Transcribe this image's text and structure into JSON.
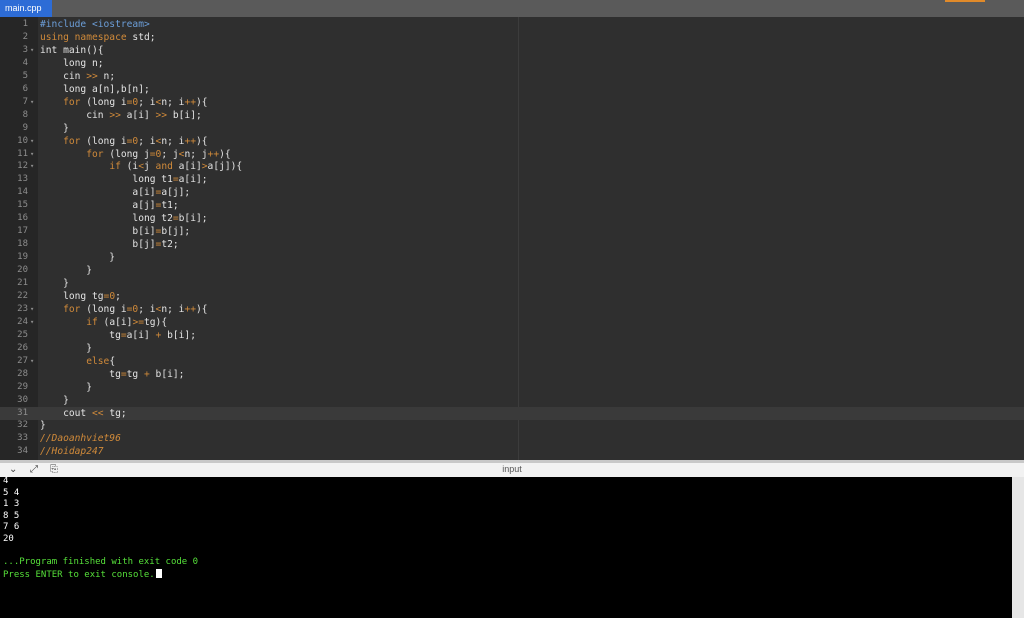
{
  "tab": {
    "label": "main.cpp"
  },
  "editor": {
    "active_line": 31,
    "lines": [
      {
        "n": "1",
        "fold": false,
        "tokens": [
          {
            "t": "#include <iostream>",
            "c": "#6c9ed8"
          }
        ]
      },
      {
        "n": "2",
        "fold": false,
        "tokens": [
          {
            "t": "using namespace",
            "c": "#d08a3a"
          },
          {
            "t": " std;",
            "c": "#e4e4e4"
          }
        ]
      },
      {
        "n": "3",
        "fold": true,
        "tokens": [
          {
            "t": "int main(){",
            "c": "#e4e4e4"
          }
        ]
      },
      {
        "n": "4",
        "fold": false,
        "tokens": [
          {
            "t": "    long n;",
            "c": "#e4e4e4"
          }
        ]
      },
      {
        "n": "5",
        "fold": false,
        "tokens": [
          {
            "t": "    cin ",
            "c": "#e4e4e4"
          },
          {
            "t": ">>",
            "c": "#d08a3a"
          },
          {
            "t": " n;",
            "c": "#e4e4e4"
          }
        ]
      },
      {
        "n": "6",
        "fold": false,
        "tokens": [
          {
            "t": "    long a[n],b[n];",
            "c": "#e4e4e4"
          }
        ]
      },
      {
        "n": "7",
        "fold": true,
        "tokens": [
          {
            "t": "    ",
            "c": "#e4e4e4"
          },
          {
            "t": "for",
            "c": "#d08a3a"
          },
          {
            "t": " (long i",
            "c": "#e4e4e4"
          },
          {
            "t": "=0",
            "c": "#d08a3a"
          },
          {
            "t": "; i",
            "c": "#e4e4e4"
          },
          {
            "t": "<",
            "c": "#d08a3a"
          },
          {
            "t": "n; i",
            "c": "#e4e4e4"
          },
          {
            "t": "++",
            "c": "#d08a3a"
          },
          {
            "t": "){",
            "c": "#e4e4e4"
          }
        ]
      },
      {
        "n": "8",
        "fold": false,
        "tokens": [
          {
            "t": "        cin ",
            "c": "#e4e4e4"
          },
          {
            "t": ">>",
            "c": "#d08a3a"
          },
          {
            "t": " a[i] ",
            "c": "#e4e4e4"
          },
          {
            "t": ">>",
            "c": "#d08a3a"
          },
          {
            "t": " b[i];",
            "c": "#e4e4e4"
          }
        ]
      },
      {
        "n": "9",
        "fold": false,
        "tokens": [
          {
            "t": "    }",
            "c": "#e4e4e4"
          }
        ]
      },
      {
        "n": "10",
        "fold": true,
        "tokens": [
          {
            "t": "    ",
            "c": "#e4e4e4"
          },
          {
            "t": "for",
            "c": "#d08a3a"
          },
          {
            "t": " (long i",
            "c": "#e4e4e4"
          },
          {
            "t": "=0",
            "c": "#d08a3a"
          },
          {
            "t": "; i",
            "c": "#e4e4e4"
          },
          {
            "t": "<",
            "c": "#d08a3a"
          },
          {
            "t": "n; i",
            "c": "#e4e4e4"
          },
          {
            "t": "++",
            "c": "#d08a3a"
          },
          {
            "t": "){",
            "c": "#e4e4e4"
          }
        ]
      },
      {
        "n": "11",
        "fold": true,
        "tokens": [
          {
            "t": "        ",
            "c": "#e4e4e4"
          },
          {
            "t": "for",
            "c": "#d08a3a"
          },
          {
            "t": " (long j",
            "c": "#e4e4e4"
          },
          {
            "t": "=0",
            "c": "#d08a3a"
          },
          {
            "t": "; j",
            "c": "#e4e4e4"
          },
          {
            "t": "<",
            "c": "#d08a3a"
          },
          {
            "t": "n; j",
            "c": "#e4e4e4"
          },
          {
            "t": "++",
            "c": "#d08a3a"
          },
          {
            "t": "){",
            "c": "#e4e4e4"
          }
        ]
      },
      {
        "n": "12",
        "fold": true,
        "tokens": [
          {
            "t": "            ",
            "c": "#e4e4e4"
          },
          {
            "t": "if",
            "c": "#d08a3a"
          },
          {
            "t": " (i",
            "c": "#e4e4e4"
          },
          {
            "t": "<",
            "c": "#d08a3a"
          },
          {
            "t": "j ",
            "c": "#e4e4e4"
          },
          {
            "t": "and",
            "c": "#d08a3a"
          },
          {
            "t": " a[i]",
            "c": "#e4e4e4"
          },
          {
            "t": ">",
            "c": "#d08a3a"
          },
          {
            "t": "a[j]){",
            "c": "#e4e4e4"
          }
        ]
      },
      {
        "n": "13",
        "fold": false,
        "tokens": [
          {
            "t": "                long t1",
            "c": "#e4e4e4"
          },
          {
            "t": "=",
            "c": "#d08a3a"
          },
          {
            "t": "a[i];",
            "c": "#e4e4e4"
          }
        ]
      },
      {
        "n": "14",
        "fold": false,
        "tokens": [
          {
            "t": "                a[i]",
            "c": "#e4e4e4"
          },
          {
            "t": "=",
            "c": "#d08a3a"
          },
          {
            "t": "a[j];",
            "c": "#e4e4e4"
          }
        ]
      },
      {
        "n": "15",
        "fold": false,
        "tokens": [
          {
            "t": "                a[j]",
            "c": "#e4e4e4"
          },
          {
            "t": "=",
            "c": "#d08a3a"
          },
          {
            "t": "t1;",
            "c": "#e4e4e4"
          }
        ]
      },
      {
        "n": "16",
        "fold": false,
        "tokens": [
          {
            "t": "                long t2",
            "c": "#e4e4e4"
          },
          {
            "t": "=",
            "c": "#d08a3a"
          },
          {
            "t": "b[i];",
            "c": "#e4e4e4"
          }
        ]
      },
      {
        "n": "17",
        "fold": false,
        "tokens": [
          {
            "t": "                b[i]",
            "c": "#e4e4e4"
          },
          {
            "t": "=",
            "c": "#d08a3a"
          },
          {
            "t": "b[j];",
            "c": "#e4e4e4"
          }
        ]
      },
      {
        "n": "18",
        "fold": false,
        "tokens": [
          {
            "t": "                b[j]",
            "c": "#e4e4e4"
          },
          {
            "t": "=",
            "c": "#d08a3a"
          },
          {
            "t": "t2;",
            "c": "#e4e4e4"
          }
        ]
      },
      {
        "n": "19",
        "fold": false,
        "tokens": [
          {
            "t": "            }",
            "c": "#e4e4e4"
          }
        ]
      },
      {
        "n": "20",
        "fold": false,
        "tokens": [
          {
            "t": "        }",
            "c": "#e4e4e4"
          }
        ]
      },
      {
        "n": "21",
        "fold": false,
        "tokens": [
          {
            "t": "    }",
            "c": "#e4e4e4"
          }
        ]
      },
      {
        "n": "22",
        "fold": false,
        "tokens": [
          {
            "t": "    long tg",
            "c": "#e4e4e4"
          },
          {
            "t": "=0",
            "c": "#d08a3a"
          },
          {
            "t": ";",
            "c": "#e4e4e4"
          }
        ]
      },
      {
        "n": "23",
        "fold": true,
        "tokens": [
          {
            "t": "    ",
            "c": "#e4e4e4"
          },
          {
            "t": "for",
            "c": "#d08a3a"
          },
          {
            "t": " (long i",
            "c": "#e4e4e4"
          },
          {
            "t": "=0",
            "c": "#d08a3a"
          },
          {
            "t": "; i",
            "c": "#e4e4e4"
          },
          {
            "t": "<",
            "c": "#d08a3a"
          },
          {
            "t": "n; i",
            "c": "#e4e4e4"
          },
          {
            "t": "++",
            "c": "#d08a3a"
          },
          {
            "t": "){",
            "c": "#e4e4e4"
          }
        ]
      },
      {
        "n": "24",
        "fold": true,
        "tokens": [
          {
            "t": "        ",
            "c": "#e4e4e4"
          },
          {
            "t": "if",
            "c": "#d08a3a"
          },
          {
            "t": " (a[i]",
            "c": "#e4e4e4"
          },
          {
            "t": ">=",
            "c": "#d08a3a"
          },
          {
            "t": "tg){",
            "c": "#e4e4e4"
          }
        ]
      },
      {
        "n": "25",
        "fold": false,
        "tokens": [
          {
            "t": "            tg",
            "c": "#e4e4e4"
          },
          {
            "t": "=",
            "c": "#d08a3a"
          },
          {
            "t": "a[i] ",
            "c": "#e4e4e4"
          },
          {
            "t": "+",
            "c": "#d08a3a"
          },
          {
            "t": " b[i];",
            "c": "#e4e4e4"
          }
        ]
      },
      {
        "n": "26",
        "fold": false,
        "tokens": [
          {
            "t": "        }",
            "c": "#e4e4e4"
          }
        ]
      },
      {
        "n": "27",
        "fold": true,
        "tokens": [
          {
            "t": "        ",
            "c": "#e4e4e4"
          },
          {
            "t": "else",
            "c": "#d08a3a"
          },
          {
            "t": "{",
            "c": "#e4e4e4"
          }
        ]
      },
      {
        "n": "28",
        "fold": false,
        "tokens": [
          {
            "t": "            tg",
            "c": "#e4e4e4"
          },
          {
            "t": "=",
            "c": "#d08a3a"
          },
          {
            "t": "tg ",
            "c": "#e4e4e4"
          },
          {
            "t": "+",
            "c": "#d08a3a"
          },
          {
            "t": " b[i];",
            "c": "#e4e4e4"
          }
        ]
      },
      {
        "n": "29",
        "fold": false,
        "tokens": [
          {
            "t": "        }",
            "c": "#e4e4e4"
          }
        ]
      },
      {
        "n": "30",
        "fold": false,
        "tokens": [
          {
            "t": "    }",
            "c": "#e4e4e4"
          }
        ]
      },
      {
        "n": "31",
        "fold": false,
        "tokens": [
          {
            "t": "    cout ",
            "c": "#e4e4e4"
          },
          {
            "t": "<<",
            "c": "#d08a3a"
          },
          {
            "t": " tg;",
            "c": "#e4e4e4"
          }
        ]
      },
      {
        "n": "32",
        "fold": false,
        "tokens": [
          {
            "t": "}",
            "c": "#e4e4e4"
          }
        ]
      },
      {
        "n": "33",
        "fold": false,
        "tokens": [
          {
            "t": "//Daoanhviet96",
            "c": "#d08a3a",
            "i": true
          }
        ]
      },
      {
        "n": "34",
        "fold": false,
        "tokens": [
          {
            "t": "//Hoidap247",
            "c": "#d08a3a",
            "i": true
          }
        ]
      }
    ]
  },
  "console": {
    "title": "input",
    "icons": [
      "chevron-down-icon",
      "expand-icon",
      "copy-icon"
    ],
    "lines": [
      {
        "t": "4",
        "green": false
      },
      {
        "t": "5 4",
        "green": false
      },
      {
        "t": "1 3",
        "green": false
      },
      {
        "t": "8 5",
        "green": false
      },
      {
        "t": "7 6",
        "green": false
      },
      {
        "t": "20",
        "green": false
      },
      {
        "t": "",
        "green": false
      },
      {
        "t": "...Program finished with exit code 0",
        "green": true
      },
      {
        "t": "Press ENTER to exit console.",
        "green": true,
        "cursor": true
      }
    ]
  }
}
